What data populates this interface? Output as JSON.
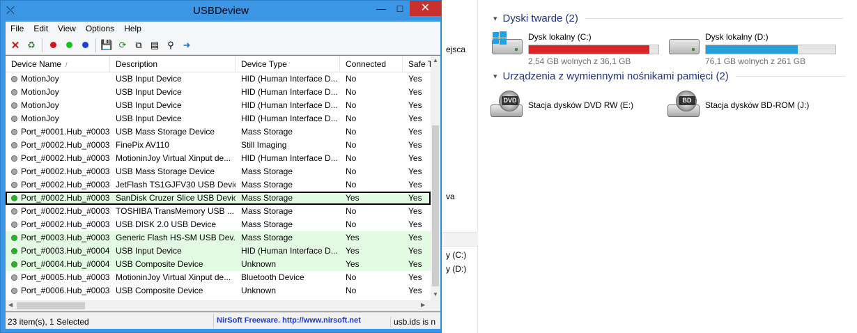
{
  "window": {
    "title": "USBDeview"
  },
  "menu": [
    "File",
    "Edit",
    "View",
    "Options",
    "Help"
  ],
  "toolbar": {
    "dot_colors": {
      "red": "#d4141a",
      "green": "#17c017",
      "blue": "#1a3fd6"
    }
  },
  "columns": [
    "Device Name",
    "Description",
    "Device Type",
    "Connected",
    "Safe T"
  ],
  "rows": [
    {
      "name": "MotionJoy",
      "desc": "USB Input Device",
      "type": "HID (Human Interface D...",
      "conn": "No",
      "safe": "Yes",
      "status": "gray"
    },
    {
      "name": "MotionJoy",
      "desc": "USB Input Device",
      "type": "HID (Human Interface D...",
      "conn": "No",
      "safe": "Yes",
      "status": "gray"
    },
    {
      "name": "MotionJoy",
      "desc": "USB Input Device",
      "type": "HID (Human Interface D...",
      "conn": "No",
      "safe": "Yes",
      "status": "gray"
    },
    {
      "name": "MotionJoy",
      "desc": "USB Input Device",
      "type": "HID (Human Interface D...",
      "conn": "No",
      "safe": "Yes",
      "status": "gray"
    },
    {
      "name": "Port_#0001.Hub_#0003",
      "desc": "USB Mass Storage Device",
      "type": "Mass Storage",
      "conn": "No",
      "safe": "Yes",
      "status": "gray"
    },
    {
      "name": "Port_#0002.Hub_#0003",
      "desc": "FinePix AV110",
      "type": "Still Imaging",
      "conn": "No",
      "safe": "Yes",
      "status": "gray"
    },
    {
      "name": "Port_#0002.Hub_#0003",
      "desc": "MotioninJoy Virtual Xinput de...",
      "type": "HID (Human Interface D...",
      "conn": "No",
      "safe": "Yes",
      "status": "gray"
    },
    {
      "name": "Port_#0002.Hub_#0003",
      "desc": "USB Mass Storage Device",
      "type": "Mass Storage",
      "conn": "No",
      "safe": "Yes",
      "status": "gray"
    },
    {
      "name": "Port_#0002.Hub_#0003",
      "desc": "JetFlash TS1GJFV30 USB Device",
      "type": "Mass Storage",
      "conn": "No",
      "safe": "Yes",
      "status": "gray"
    },
    {
      "name": "Port_#0002.Hub_#0003",
      "desc": "SanDisk Cruzer Slice USB Device",
      "type": "Mass Storage",
      "conn": "Yes",
      "safe": "Yes",
      "status": "green",
      "selected": true
    },
    {
      "name": "Port_#0002.Hub_#0003",
      "desc": "TOSHIBA TransMemory USB ...",
      "type": "Mass Storage",
      "conn": "No",
      "safe": "Yes",
      "status": "gray"
    },
    {
      "name": "Port_#0002.Hub_#0003",
      "desc": "USB DISK 2.0 USB Device",
      "type": "Mass Storage",
      "conn": "No",
      "safe": "Yes",
      "status": "gray"
    },
    {
      "name": "Port_#0003.Hub_#0003",
      "desc": "Generic Flash HS-SM USB Dev...",
      "type": "Mass Storage",
      "conn": "Yes",
      "safe": "Yes",
      "status": "green"
    },
    {
      "name": "Port_#0003.Hub_#0004",
      "desc": "USB Input Device",
      "type": "HID (Human Interface D...",
      "conn": "Yes",
      "safe": "Yes",
      "status": "green"
    },
    {
      "name": "Port_#0004.Hub_#0004",
      "desc": "USB Composite Device",
      "type": "Unknown",
      "conn": "Yes",
      "safe": "Yes",
      "status": "green"
    },
    {
      "name": "Port_#0005.Hub_#0003",
      "desc": "MotioninJoy Virtual Xinput de...",
      "type": "Bluetooth Device",
      "conn": "No",
      "safe": "Yes",
      "status": "gray"
    },
    {
      "name": "Port_#0006.Hub_#0003",
      "desc": "USB Composite Device",
      "type": "Unknown",
      "conn": "No",
      "safe": "Yes",
      "status": "gray"
    }
  ],
  "status": {
    "count": "23 item(s), 1 Selected",
    "credit": "NirSoft Freeware.  http://www.nirsoft.net",
    "usbids": "usb.ids is n"
  },
  "explorer": {
    "left_fragments": [
      "ejsca",
      "va",
      "y (C:)",
      "y (D:)"
    ],
    "hard_drives_header": "Dyski twarde (2)",
    "removable_header": "Urządzenia z wymiennymi nośnikami pamięci (2)",
    "drives": [
      {
        "name": "Dysk lokalny (C:)",
        "free": "2,54 GB wolnych z 36,1 GB",
        "used_fraction": 0.93,
        "bar_color": "#da2626"
      },
      {
        "name": "Dysk lokalny (D:)",
        "free": "76,1 GB wolnych z 261 GB",
        "used_fraction": 0.71,
        "bar_color": "#26a0da"
      }
    ],
    "optical": [
      {
        "name": "Stacja dysków DVD RW (E:)",
        "badge": "DVD"
      },
      {
        "name": "Stacja dysków BD-ROM (J:)",
        "badge": "BD"
      }
    ]
  },
  "colors": {
    "connected_dot": "#17c017",
    "disconnected_dot": "#a8a8a8",
    "connected_row": "#e3fbe3"
  }
}
